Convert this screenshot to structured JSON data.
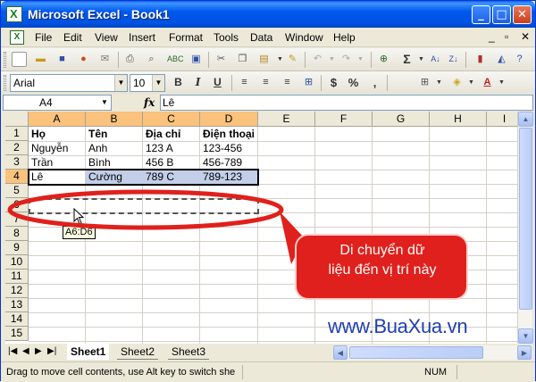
{
  "window": {
    "title": "Microsoft Excel - Book1",
    "controls": {
      "minimize": "_",
      "maximize": "□",
      "close": "✕"
    }
  },
  "menu": {
    "items": [
      "File",
      "Edit",
      "View",
      "Insert",
      "Format",
      "Tools",
      "Data",
      "Window",
      "Help"
    ],
    "right_controls": {
      "minimize": "_",
      "restore": "▫",
      "close": "✕"
    }
  },
  "toolbar_standard": {
    "icons": [
      "new-icon",
      "open-icon",
      "save-icon",
      "permission-icon",
      "email-icon",
      "print-icon",
      "print-preview-icon",
      "spelling-icon",
      "cut-icon",
      "copy-icon",
      "paste-icon",
      "format-painter-icon",
      "undo-icon",
      "redo-icon",
      "hyperlink-icon",
      "autosum-icon",
      "sort-ascending-icon",
      "sort-descending-icon",
      "chart-wizard-icon",
      "help-icon"
    ]
  },
  "toolbar_formatting": {
    "font_name": "Arial",
    "font_size": "10",
    "bold": "B",
    "italic": "I",
    "underline": "U",
    "currency": "$",
    "percent": "%",
    "comma": ","
  },
  "formula_bar": {
    "name_box": "A4",
    "fx": "fx",
    "content": "Lê"
  },
  "sheet": {
    "columns": [
      "A",
      "B",
      "C",
      "D",
      "E",
      "F",
      "G",
      "H",
      "I"
    ],
    "rows": [
      "1",
      "2",
      "3",
      "4",
      "5",
      "6",
      "7",
      "8",
      "9",
      "10",
      "11",
      "12",
      "13",
      "14",
      "15"
    ],
    "cells": [
      [
        "Họ",
        "Tên",
        "Địa chỉ",
        "Điện thoại"
      ],
      [
        "Nguyễn",
        "Anh",
        "123 A",
        "123-456"
      ],
      [
        "Trần",
        "Bình",
        "456 B",
        "456-789"
      ],
      [
        "Lê",
        "Cường",
        "789 C",
        "789-123"
      ]
    ],
    "drag_tooltip": "A6:D6",
    "tabs": [
      "Sheet1",
      "Sheet2",
      "Sheet3"
    ]
  },
  "status_bar": {
    "message": "Drag to move cell contents, use Alt key to switch she",
    "num": "NUM"
  },
  "annotation": {
    "callout_line1": "Di chuyển dữ",
    "callout_line2": "liệu đến vị trí này",
    "watermark": "www.BuaXua.vn",
    "color_red": "#e0201c"
  }
}
